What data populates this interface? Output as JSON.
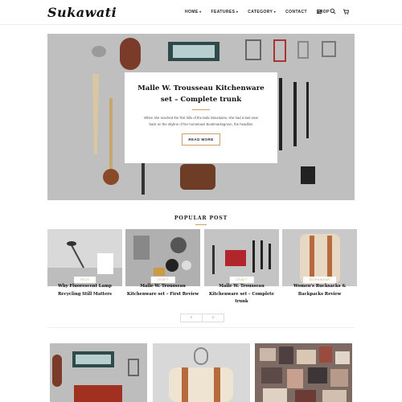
{
  "header": {
    "logo": "Sukawati",
    "nav": [
      {
        "label": "HOME",
        "dropdown": true
      },
      {
        "label": "FEATURES",
        "dropdown": true
      },
      {
        "label": "CATEGORY",
        "dropdown": true
      },
      {
        "label": "CONTACT",
        "dropdown": false
      },
      {
        "label": "SHOP",
        "dropdown": false
      }
    ],
    "icons": [
      "menu-icon",
      "search-icon",
      "cart-icon"
    ]
  },
  "hero": {
    "title": "Malle W. Trousseau Kitchenware set – Complete trunk",
    "excerpt": "When she reached the first hills of the Italic Mountains, she had a last view back on the skyline of her hometown Bookmarksgrove, the headline",
    "button": "READ MORE"
  },
  "popular": {
    "title": "POPULAR POST",
    "cards": [
      {
        "tag": "TECH",
        "title": "Why Fluorescent Lamp Recycling Still Matters"
      },
      {
        "tag": "CRAFT",
        "title": "Malle W. Trousseau Kitchenware set – First Review"
      },
      {
        "tag": "CRAFT",
        "title": "Malle W. Trousseau Kitchenware set – Complete trunk"
      },
      {
        "tag": "WORKWEAR",
        "title": "Women's Rucksacks & Backpacks Review"
      }
    ],
    "prev": "‹",
    "next": "›"
  },
  "colors": {
    "accent": "#c9a36b",
    "hero_bg": "#bcbcbc"
  }
}
